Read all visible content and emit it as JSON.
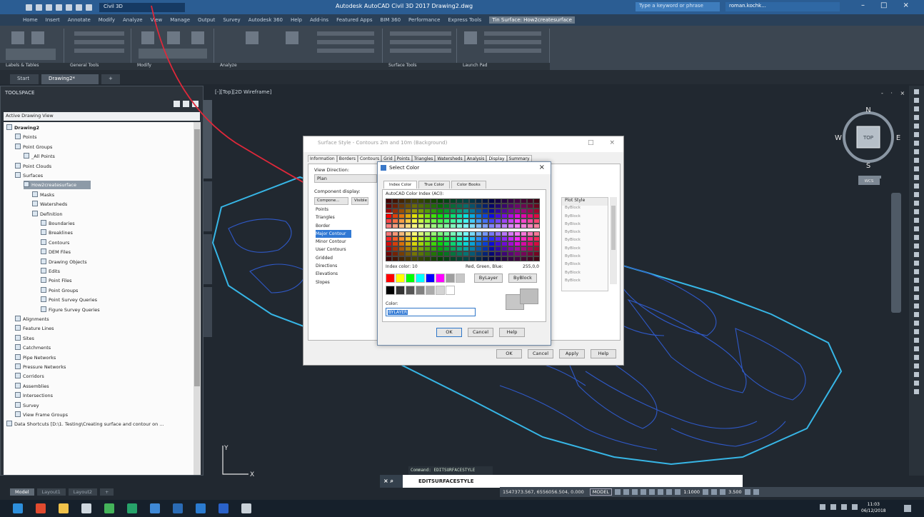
{
  "title_bar": {
    "workspace": "Civil 3D",
    "app_title": "Autodesk AutoCAD Civil 3D 2017  Drawing2.dwg",
    "search_placeholder": "Type a keyword or phrase",
    "user": "roman.kochk..."
  },
  "ribbon_tabs": [
    "Home",
    "Insert",
    "Annotate",
    "Modify",
    "Analyze",
    "View",
    "Manage",
    "Output",
    "Survey",
    "Autodesk 360",
    "Help",
    "Add-ins",
    "Featured Apps",
    "BIM 360",
    "Performance",
    "Express Tools",
    "Tin Surface: How2createsurface"
  ],
  "ribbon_active_tab": "Tin Surface: How2createsurface",
  "ribbon_panels": [
    "Labels & Tables",
    "General Tools",
    "Modify",
    "Analyze",
    "Surface Tools",
    "Launch Pad"
  ],
  "file_tabs": [
    "Start",
    "Drawing2*",
    "+"
  ],
  "toolspace": {
    "title": "TOOLSPACE",
    "view_dropdown": "Active Drawing View",
    "tree": [
      {
        "label": "Drawing2",
        "level": 0,
        "bold": true
      },
      {
        "label": "Points",
        "level": 1
      },
      {
        "label": "Point Groups",
        "level": 1
      },
      {
        "label": "_All Points",
        "level": 2
      },
      {
        "label": "Point Clouds",
        "level": 1
      },
      {
        "label": "Surfaces",
        "level": 1
      },
      {
        "label": "How2createsurface",
        "level": 2,
        "selected": true
      },
      {
        "label": "Masks",
        "level": 3
      },
      {
        "label": "Watersheds",
        "level": 3
      },
      {
        "label": "Definition",
        "level": 3
      },
      {
        "label": "Boundaries",
        "level": 4
      },
      {
        "label": "Breaklines",
        "level": 4
      },
      {
        "label": "Contours",
        "level": 4
      },
      {
        "label": "DEM Files",
        "level": 4
      },
      {
        "label": "Drawing Objects",
        "level": 4
      },
      {
        "label": "Edits",
        "level": 4
      },
      {
        "label": "Point Files",
        "level": 4
      },
      {
        "label": "Point Groups",
        "level": 4
      },
      {
        "label": "Point Survey Queries",
        "level": 4
      },
      {
        "label": "Figure Survey Queries",
        "level": 4
      },
      {
        "label": "Alignments",
        "level": 1
      },
      {
        "label": "Feature Lines",
        "level": 1
      },
      {
        "label": "Sites",
        "level": 1
      },
      {
        "label": "Catchments",
        "level": 1
      },
      {
        "label": "Pipe Networks",
        "level": 1
      },
      {
        "label": "Pressure Networks",
        "level": 1
      },
      {
        "label": "Corridors",
        "level": 1
      },
      {
        "label": "Assemblies",
        "level": 1
      },
      {
        "label": "Intersections",
        "level": 1
      },
      {
        "label": "Survey",
        "level": 1
      },
      {
        "label": "View Frame Groups",
        "level": 1
      },
      {
        "label": "Data Shortcuts [D:\\1. Testing\\Creating surface and contour on ...",
        "level": 0
      }
    ],
    "side_tabs": [
      "Prospector",
      "Settings",
      "Survey",
      "Toolbox"
    ]
  },
  "viewport": {
    "label": "[-][Top][2D Wireframe]",
    "viewcube": {
      "n": "N",
      "s": "S",
      "e": "E",
      "w": "W",
      "face": "TOP",
      "wcs": "WCS"
    },
    "ucs": {
      "x": "X",
      "y": "Y"
    },
    "controls": "- · ×"
  },
  "surface_style_dialog": {
    "title": "Surface Style - Contours 2m and 10m (Background)",
    "tabs": [
      "Information",
      "Borders",
      "Contours",
      "Grid",
      "Points",
      "Triangles",
      "Watersheds",
      "Analysis",
      "Display",
      "Summary"
    ],
    "active_tab": "Display",
    "view_direction_label": "View Direction:",
    "view_direction_value": "Plan",
    "component_display_label": "Component display:",
    "col_component": "Compone...",
    "col_visible": "Visible",
    "col_plot_style": "Plot Style",
    "components": [
      "Points",
      "Triangles",
      "Border",
      "Major Contour",
      "Minor Contour",
      "User Contours",
      "Gridded",
      "Directions",
      "Elevations",
      "Slopes"
    ],
    "selected_component": "Major Contour",
    "plot_styles": [
      "ByBlock",
      "ByBlock",
      "ByBlock",
      "ByBlock",
      "ByBlock",
      "ByBlock",
      "ByBlock",
      "ByBlock",
      "ByBlock",
      "ByBlock"
    ],
    "buttons": [
      "OK",
      "Cancel",
      "Apply",
      "Help"
    ]
  },
  "select_color_dialog": {
    "title": "Select Color",
    "tabs": [
      "Index Color",
      "True Color",
      "Color Books"
    ],
    "active_tab": "Index Color",
    "aci_label": "AutoCAD Color Index (ACI):",
    "index_color_label": "Index color:",
    "index_color_value": "10",
    "rgb_label": "Red, Green, Blue:",
    "rgb_value": "255,0,0",
    "bylayer_button": "ByLayer",
    "byblock_button": "ByBlock",
    "color_label": "Color:",
    "color_value": "BYLAYER",
    "buttons": [
      "OK",
      "Cancel",
      "Help"
    ]
  },
  "command": {
    "history": "Command: EDITSURFACESTYLE",
    "current": "EDITSURFACESTYLE"
  },
  "layout_tabs": [
    "Model",
    "Layout1",
    "Layout2",
    "+"
  ],
  "status_bar": {
    "coordinates": "1547373.567, 6556056.504, 0.000",
    "model": "MODEL",
    "scale": "1:1000",
    "value": "3.500"
  },
  "taskbar": {
    "time": "11:03",
    "date": "06/12/2018"
  },
  "colors": {
    "accent_blue": "#2b5d93",
    "contour_cyan": "#37b6e6",
    "contour_blue": "#2f59c8",
    "annotation_red": "#e0283a",
    "selection_blue": "#3179d4"
  }
}
